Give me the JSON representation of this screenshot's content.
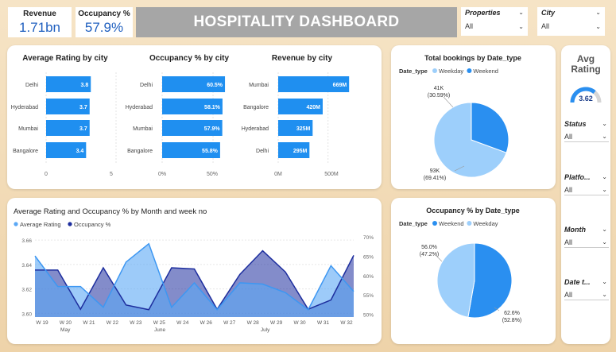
{
  "header": {
    "title": "HOSPITALITY DASHBOARD"
  },
  "kpis": [
    {
      "label": "Revenue",
      "value": "1.71bn"
    },
    {
      "label": "Occupancy %",
      "value": "57.9%"
    }
  ],
  "slicers_top": [
    {
      "label": "Properties",
      "value": "All"
    },
    {
      "label": "City",
      "value": "All"
    }
  ],
  "side": {
    "gauge_title": "Avg Rating",
    "gauge_value": "3.62",
    "gauge_fraction": 0.724,
    "slicers": [
      {
        "label": "Status",
        "value": "All"
      },
      {
        "label": "Platfo...",
        "value": "All"
      },
      {
        "label": "Month",
        "value": "All"
      },
      {
        "label": "Date t...",
        "value": "All"
      }
    ]
  },
  "colors": {
    "accent": "#1f8ff0",
    "dark": "#1d2e9e",
    "light": "#9dcffb",
    "area_light": "#5ba8f5",
    "title_bar": "#a6a6a6"
  },
  "chart_data": [
    {
      "type": "bar",
      "title": "Average Rating by city",
      "categories": [
        "Delhi",
        "Hyderabad",
        "Mumbai",
        "Bangalore"
      ],
      "values": [
        3.8,
        3.7,
        3.7,
        3.4
      ],
      "labels": [
        "3.8",
        "3.7",
        "3.7",
        "3.4"
      ],
      "xlim": [
        0,
        5
      ],
      "ticks": [
        "0",
        "5"
      ]
    },
    {
      "type": "bar",
      "title": "Occupancy % by city",
      "categories": [
        "Delhi",
        "Hyderabad",
        "Mumbai",
        "Bangalore"
      ],
      "values": [
        60.5,
        58.1,
        57.9,
        55.8
      ],
      "labels": [
        "60.5%",
        "58.1%",
        "57.9%",
        "55.8%"
      ],
      "xlim": [
        0,
        75
      ],
      "ticks": [
        "0%",
        "50%"
      ]
    },
    {
      "type": "bar",
      "title": "Revenue by city",
      "categories": [
        "Mumbai",
        "Bangalore",
        "Hyderabad",
        "Delhi"
      ],
      "values": [
        669,
        420,
        325,
        295
      ],
      "labels": [
        "669M",
        "420M",
        "325M",
        "295M"
      ],
      "xlim": [
        0,
        750
      ],
      "ticks": [
        "0M",
        "500M"
      ]
    },
    {
      "type": "pie",
      "title": "Total bookings by Date_type",
      "legend_title": "Date_type",
      "slices": [
        {
          "name": "Weekday",
          "value": 93,
          "label": "93K (69.41%)",
          "color": "#9dcffb"
        },
        {
          "name": "Weekend",
          "value": 41,
          "label": "41K (30.59%)",
          "color": "#2a8ff0"
        }
      ]
    },
    {
      "type": "pie",
      "title": "Occupancy % by Date_type",
      "legend_title": "Date_type",
      "slices": [
        {
          "name": "Weekend",
          "value": 62.6,
          "label": "62.6% (52.8%)",
          "color": "#2a8ff0"
        },
        {
          "name": "Weekday",
          "value": 56.0,
          "label": "56.0% (47.2%)",
          "color": "#9dcffb"
        }
      ]
    },
    {
      "type": "area",
      "title": "Average Rating and Occupancy % by Month and week no",
      "x": [
        "W 19",
        "W 20",
        "W 21",
        "W 22",
        "W 23",
        "W 25",
        "W 24",
        "W 26",
        "W 27",
        "W 28",
        "W 29",
        "W 30",
        "W 31",
        "W 32"
      ],
      "months": [
        {
          "label": "May",
          "from": 1,
          "to": 2
        },
        {
          "label": "June",
          "from": 4,
          "to": 7
        },
        {
          "label": "July",
          "from": 8,
          "to": 12
        }
      ],
      "y_left": {
        "ticks": [
          "3.60",
          "3.62",
          "3.64",
          "3.66"
        ],
        "range": [
          3.597,
          3.664
        ]
      },
      "y_right": {
        "ticks": [
          "50%",
          "55%",
          "60%",
          "65%",
          "70%"
        ],
        "range": [
          49.3,
          70.4
        ]
      },
      "series": [
        {
          "name": "Average Rating",
          "axis": "left",
          "values": [
            3.647,
            3.622,
            3.622,
            3.605,
            3.642,
            3.657,
            3.605,
            3.625,
            3.603,
            3.625,
            3.624,
            3.617,
            3.603,
            3.639,
            3.618
          ]
        },
        {
          "name": "Occupancy %",
          "axis": "right",
          "values": [
            61.4,
            61.4,
            51.3,
            62.0,
            52.4,
            51.2,
            62.0,
            61.7,
            51.3,
            60.3,
            66.4,
            60.9,
            51.3,
            53.7,
            65.2
          ]
        }
      ]
    }
  ]
}
